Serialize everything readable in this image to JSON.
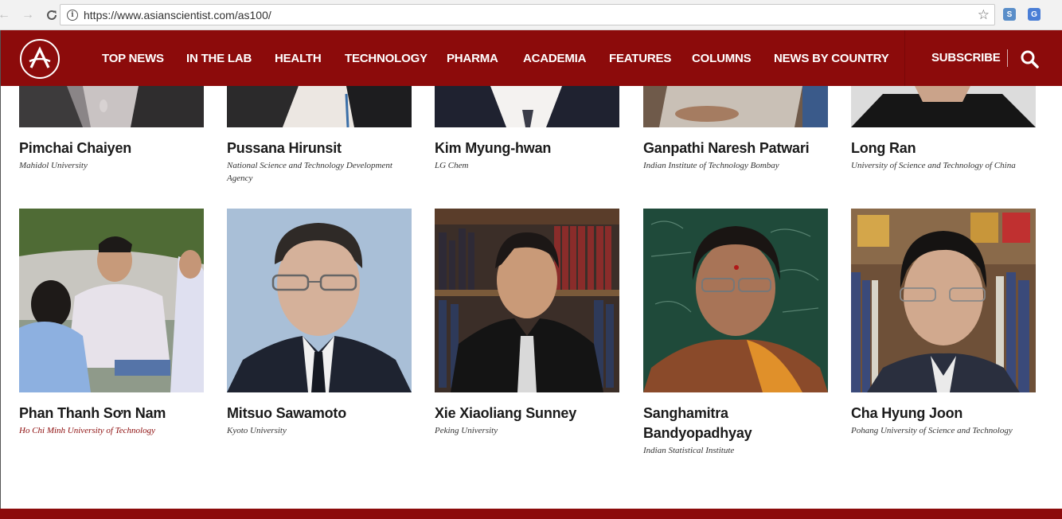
{
  "browser": {
    "url": "https://www.asianscientist.com/as100/"
  },
  "nav": {
    "items": [
      "TOP NEWS",
      "IN THE LAB",
      "HEALTH",
      "TECHNOLOGY",
      "PHARMA",
      "ACADEMIA",
      "FEATURES",
      "COLUMNS",
      "NEWS BY COUNTRY"
    ],
    "subscribe": "SUBSCRIBE"
  },
  "people": [
    {
      "name": "Pimchai Chaiyen",
      "affiliation": "Mahidol University"
    },
    {
      "name": "Pussana Hirunsit",
      "affiliation": "National Science and Technology Development Agency"
    },
    {
      "name": "Kim Myung-hwan",
      "affiliation": "LG Chem"
    },
    {
      "name": "Ganpathi Naresh Patwari",
      "affiliation": "Indian Institute of Technology Bombay"
    },
    {
      "name": "Long Ran",
      "affiliation": "University of Science and Technology of China"
    },
    {
      "name": "Phan Thanh Sơn Nam",
      "affiliation": "Ho Chi Minh University of Technology"
    },
    {
      "name": "Mitsuo Sawamoto",
      "affiliation": "Kyoto University"
    },
    {
      "name": "Xie Xiaoliang Sunney",
      "affiliation": "Peking University"
    },
    {
      "name": "Sanghamitra Bandyopadhyay",
      "affiliation": "Indian Statistical Institute"
    },
    {
      "name": "Cha Hyung Joon",
      "affiliation": "Pohang University of Science and Technology"
    }
  ],
  "colors": {
    "brand": "#8c0b0b",
    "link_affiliation": "#8c0b0b"
  }
}
